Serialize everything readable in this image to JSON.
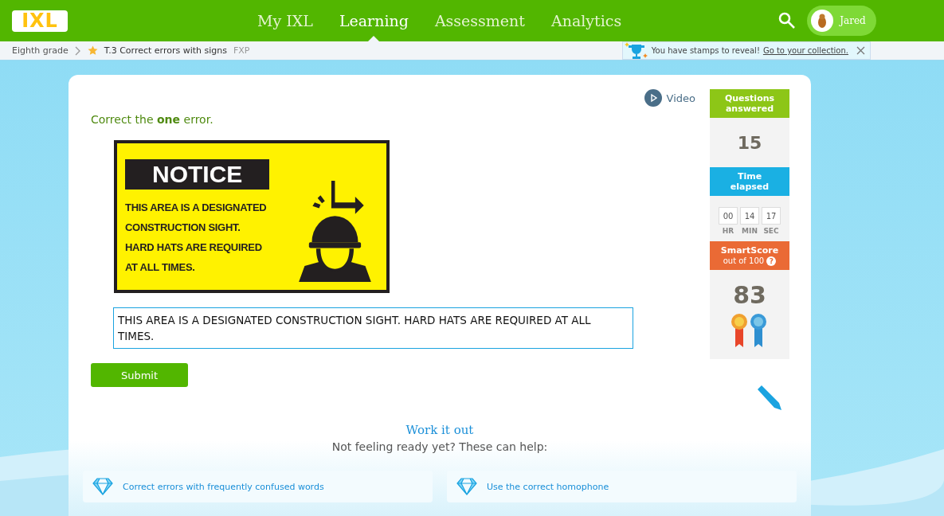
{
  "logo": "IXL",
  "nav": [
    {
      "label": "My IXL",
      "selected": false
    },
    {
      "label": "Learning",
      "selected": true
    },
    {
      "label": "Assessment",
      "selected": false
    },
    {
      "label": "Analytics",
      "selected": false
    }
  ],
  "user": {
    "name": "Jared"
  },
  "breadcrumb": {
    "grade": "Eighth grade",
    "skill": "T.3 Correct errors with signs",
    "code": "FXP"
  },
  "notice": {
    "text": "You have stamps to reveal!",
    "link": "Go to your collection."
  },
  "video": "Video",
  "prompt": "Correct the **one** error.",
  "sign": {
    "title": "NOTICE",
    "lines": [
      "THIS AREA IS A DESIGNATED",
      "CONSTRUCTION SIGHT.",
      "HARD HATS ARE REQUIRED",
      "AT ALL TIMES."
    ]
  },
  "answer": {
    "value": "THIS AREA IS A DESIGNATED CONSTRUCTION SIGHT. HARD HATS ARE REQUIRED AT ALL TIMES."
  },
  "submit": "Submit",
  "stats": {
    "questions_label": "Questions answered",
    "questions": "15",
    "time_label": "Time elapsed",
    "time": [
      {
        "value": "00",
        "unit": "HR"
      },
      {
        "value": "14",
        "unit": "MIN"
      },
      {
        "value": "17",
        "unit": "SEC"
      }
    ],
    "score_label": "SmartScore",
    "score_sub": "out of 100",
    "help": "?",
    "score": "83"
  },
  "work_it_out": {
    "title": "Work it out",
    "subtitle": "Not feeling ready yet? These can help:",
    "links": [
      "Correct errors with frequently confused words",
      "Use the correct homophone"
    ]
  }
}
